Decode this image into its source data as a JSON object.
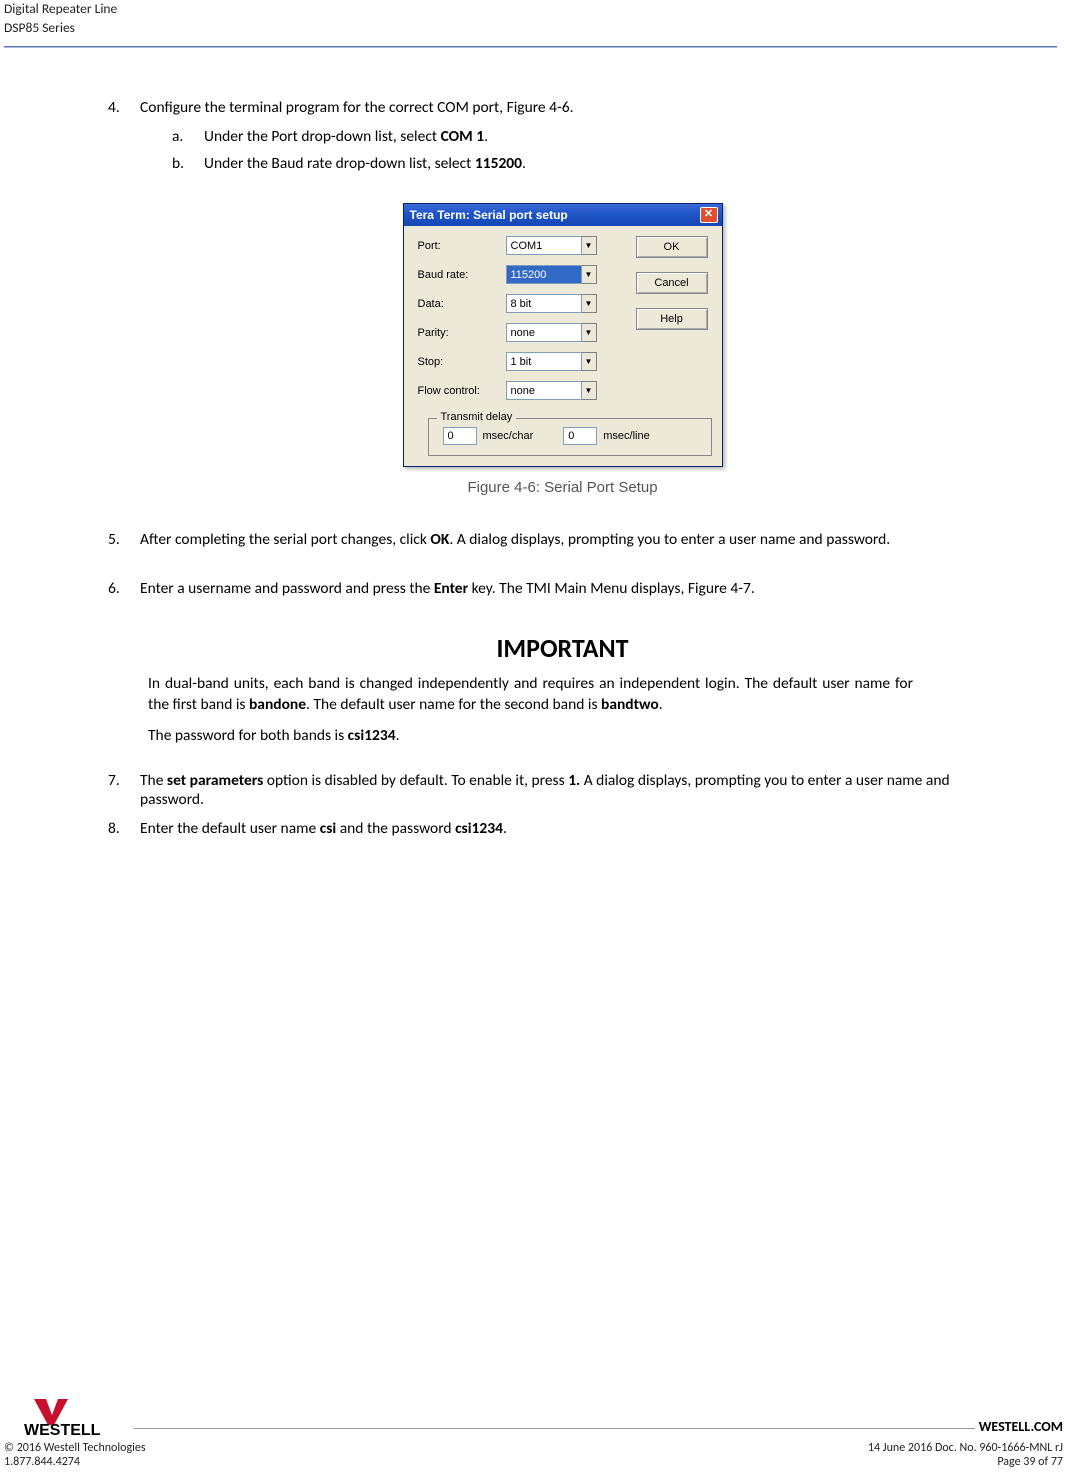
{
  "header": {
    "line1": "Digital Repeater Line",
    "line2": "DSP85 Series"
  },
  "steps": {
    "s4": {
      "num": "4.",
      "text_pre": "Configure the terminal program for the correct COM port, Figure 4-6.",
      "a": {
        "num": "a.",
        "pre": "Under the Port drop-down list, select ",
        "bold": "COM 1",
        "post": "."
      },
      "b": {
        "num": "b.",
        "pre": "Under the Baud rate drop-down list, select ",
        "bold": "115200",
        "post": "."
      }
    },
    "s5": {
      "num": "5.",
      "pre": "After completing the serial port changes, click ",
      "bold": "OK",
      "post": ". A dialog displays, prompting you to enter a user name and password."
    },
    "s6": {
      "num": "6.",
      "pre": "Enter a username and password and press the ",
      "bold": "Enter",
      "post": " key. The TMI Main Menu displays, Figure 4-7."
    },
    "s7": {
      "num": "7.",
      "pre": "The ",
      "bold1": "set parameters",
      "mid": " option is disabled by default.  To enable it, press ",
      "bold2": "1.",
      "post": "  A dialog displays, prompting you to enter a user name and password."
    },
    "s8": {
      "num": "8.",
      "pre": "Enter the default user name ",
      "bold1": "csi",
      "mid": " and the password ",
      "bold2": "csi1234",
      "post": "."
    }
  },
  "dialog": {
    "title": "Tera Term: Serial port setup",
    "labels": {
      "port": "Port:",
      "baud": "Baud rate:",
      "data": "Data:",
      "parity": "Parity:",
      "stop": "Stop:",
      "flow": "Flow control:"
    },
    "values": {
      "port": "COM1",
      "baud": "115200",
      "data": "8 bit",
      "parity": "none",
      "stop": "1 bit",
      "flow": "none"
    },
    "buttons": {
      "ok": "OK",
      "cancel": "Cancel",
      "help": "Help"
    },
    "transmit": {
      "legend": "Transmit delay",
      "char_val": "0",
      "char_unit": "msec/char",
      "line_val": "0",
      "line_unit": "msec/line"
    },
    "caption": "Figure 4-6: Serial Port Setup"
  },
  "important": {
    "title": "IMPORTANT",
    "p1_a": "In dual-band units, each band is changed independently and requires an independent login.  The default user name for the first band is ",
    "p1_b1": "bandone",
    "p1_b": ".  The default user name for the second band is ",
    "p1_b2": "bandtwo",
    "p1_c": ".",
    "p2_a": "The password for both bands is ",
    "p2_b": "csi1234",
    "p2_c": "."
  },
  "footer": {
    "brand": "WESTELL.COM",
    "copyright": "© 2016 Westell Technologies",
    "docline": "14 June 2016 Doc. No. 960-1666-MNL rJ",
    "phone": "1.877.844.4274",
    "page": "Page 39 of 77",
    "logo_text": "WESTELL"
  }
}
